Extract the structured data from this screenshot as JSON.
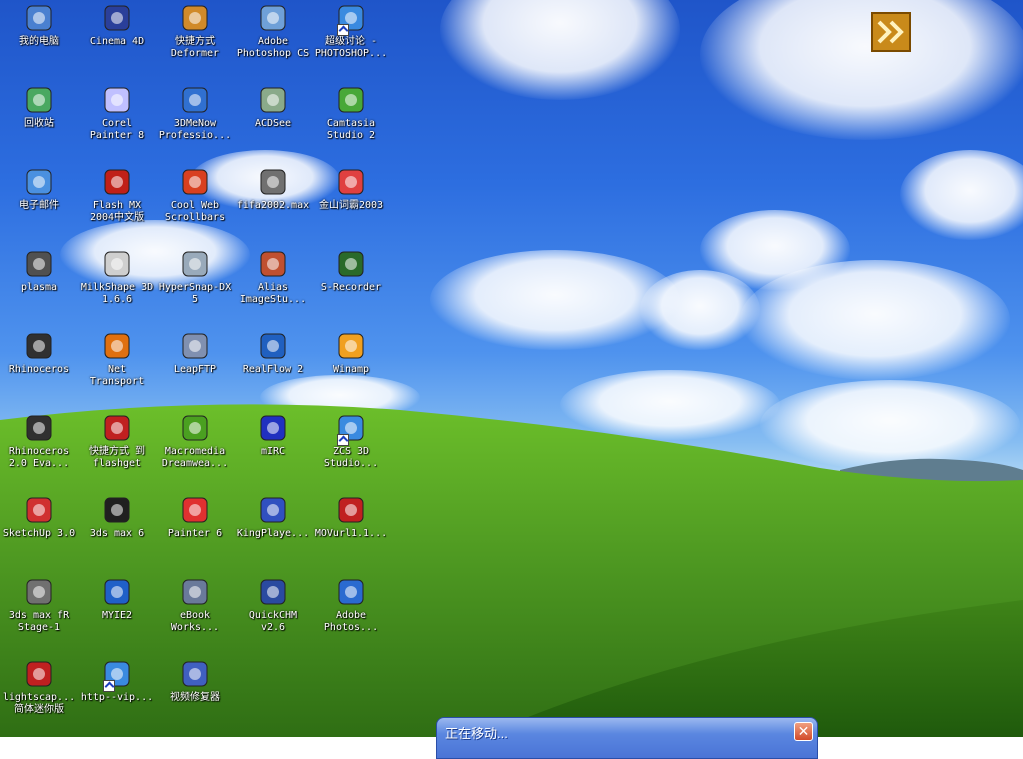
{
  "desktop": {
    "wallpaper": "Bliss",
    "icons": [
      {
        "id": "my-computer",
        "label": "我的电脑",
        "icon": "computer-icon",
        "shortcut": false
      },
      {
        "id": "cinema4d",
        "label": "Cinema 4D",
        "icon": "cinema4d-icon",
        "shortcut": false
      },
      {
        "id": "deformer",
        "label": "快捷方式\nDeformer",
        "icon": "deformer-icon",
        "shortcut": false
      },
      {
        "id": "photoshop-cs",
        "label": "Adobe\nPhotoshop CS",
        "icon": "photoshop-cs-icon",
        "shortcut": false
      },
      {
        "id": "super-discussion",
        "label": "超级讨论 -\nPHOTOSHOP...",
        "icon": "ie-page-icon",
        "shortcut": true
      },
      {
        "id": "recycle-bin",
        "label": "回收站",
        "icon": "recycle-bin-icon",
        "shortcut": false
      },
      {
        "id": "corel-painter8",
        "label": "Corel\nPainter 8",
        "icon": "painter-icon",
        "shortcut": false
      },
      {
        "id": "3dmenow",
        "label": "3DMeNow\nProfessio...",
        "icon": "3dmenow-icon",
        "shortcut": false
      },
      {
        "id": "acdsee",
        "label": "ACDSee",
        "icon": "acdsee-eye-icon",
        "shortcut": false
      },
      {
        "id": "camtasia",
        "label": "Camtasia\nStudio 2",
        "icon": "camtasia-icon",
        "shortcut": false
      },
      {
        "id": "email",
        "label": "电子邮件",
        "icon": "email-icon",
        "shortcut": false
      },
      {
        "id": "flash-mx",
        "label": "Flash MX\n2004中文版",
        "icon": "flash-icon",
        "shortcut": false
      },
      {
        "id": "coolweb",
        "label": "Cool Web\nScrollbars",
        "icon": "coolweb-icon",
        "shortcut": false
      },
      {
        "id": "fifa2002",
        "label": "fifa2002.max",
        "icon": "max-file-icon",
        "shortcut": false
      },
      {
        "id": "jinshan",
        "label": "金山词霸2003",
        "icon": "jinshan-icon",
        "shortcut": false
      },
      {
        "id": "plasma",
        "label": "plasma",
        "icon": "plasma-icon",
        "shortcut": false
      },
      {
        "id": "milkshape",
        "label": "MilkShape 3D\n1.6.6",
        "icon": "milkshape-icon",
        "shortcut": false
      },
      {
        "id": "hypersnap",
        "label": "HyperSnap-DX\n5",
        "icon": "camera-icon",
        "shortcut": false
      },
      {
        "id": "alias",
        "label": "Alias\nImageStu...",
        "icon": "alias-icon",
        "shortcut": false
      },
      {
        "id": "s-recorder",
        "label": "S-Recorder",
        "icon": "clapper-icon",
        "shortcut": false
      },
      {
        "id": "rhinoceros",
        "label": "Rhinoceros",
        "icon": "rhino-icon",
        "shortcut": false
      },
      {
        "id": "net-transport",
        "label": "Net\nTransport",
        "icon": "net-transport-icon",
        "shortcut": false
      },
      {
        "id": "leapftp",
        "label": "LeapFTP",
        "icon": "leapftp-icon",
        "shortcut": false
      },
      {
        "id": "realflow",
        "label": "RealFlow 2",
        "icon": "wave-icon",
        "shortcut": false
      },
      {
        "id": "winamp",
        "label": "Winamp",
        "icon": "winamp-icon",
        "shortcut": false
      },
      {
        "id": "rhino2",
        "label": "Rhinoceros\n2.0 Eva...",
        "icon": "rhino-icon",
        "shortcut": false
      },
      {
        "id": "flashget",
        "label": "快捷方式 到\nflashget",
        "icon": "flashget-icon",
        "shortcut": false
      },
      {
        "id": "dreamweaver",
        "label": "Macromedia\nDreamwea...",
        "icon": "dreamweaver-icon",
        "shortcut": false
      },
      {
        "id": "mirc",
        "label": "mIRC",
        "icon": "mirc-icon",
        "shortcut": false
      },
      {
        "id": "zcs3d",
        "label": "ZCS 3D\nStudio...",
        "icon": "ie-page-icon",
        "shortcut": true
      },
      {
        "id": "sketchup",
        "label": "SketchUp 3.0",
        "icon": "sketchup-icon",
        "shortcut": false
      },
      {
        "id": "3dsmax6",
        "label": "3ds max 6",
        "icon": "3dsmax-icon",
        "shortcut": false
      },
      {
        "id": "painter6",
        "label": "Painter 6",
        "icon": "paint-bucket-icon",
        "shortcut": false
      },
      {
        "id": "kingplayer",
        "label": "KingPlaye...",
        "icon": "kingplayer-icon",
        "shortcut": false
      },
      {
        "id": "movurl",
        "label": "MOVurl1.1...",
        "icon": "rocket-icon",
        "shortcut": false
      },
      {
        "id": "3dsmax-stage",
        "label": "3ds max fR\nStage-1",
        "icon": "max-file-icon",
        "shortcut": false
      },
      {
        "id": "myie2",
        "label": "MYIE2",
        "icon": "myie2-icon",
        "shortcut": false
      },
      {
        "id": "ebook",
        "label": "eBook\nWorks...",
        "icon": "ebook-icon",
        "shortcut": false
      },
      {
        "id": "quickchm",
        "label": "QuickCHM\nv2.6",
        "icon": "books-icon",
        "shortcut": false
      },
      {
        "id": "adobe-photos",
        "label": "Adobe\nPhotos...",
        "icon": "photoshop-eye-icon",
        "shortcut": false
      },
      {
        "id": "lightscape",
        "label": "lightscap...\n简体迷你版",
        "icon": "lightscape-icon",
        "shortcut": false
      },
      {
        "id": "http-vip",
        "label": "http--vip...",
        "icon": "ie-page-icon",
        "shortcut": true
      },
      {
        "id": "video-repair",
        "label": "视频修复器",
        "icon": "video-repair-icon",
        "shortcut": false
      }
    ]
  },
  "move_dialog": {
    "title": "正在移动...",
    "close_label": "✕"
  },
  "colors": {
    "sky_top": "#1f55c9",
    "grass": "#4f9a22",
    "dialog_title": "#4a74d6"
  }
}
